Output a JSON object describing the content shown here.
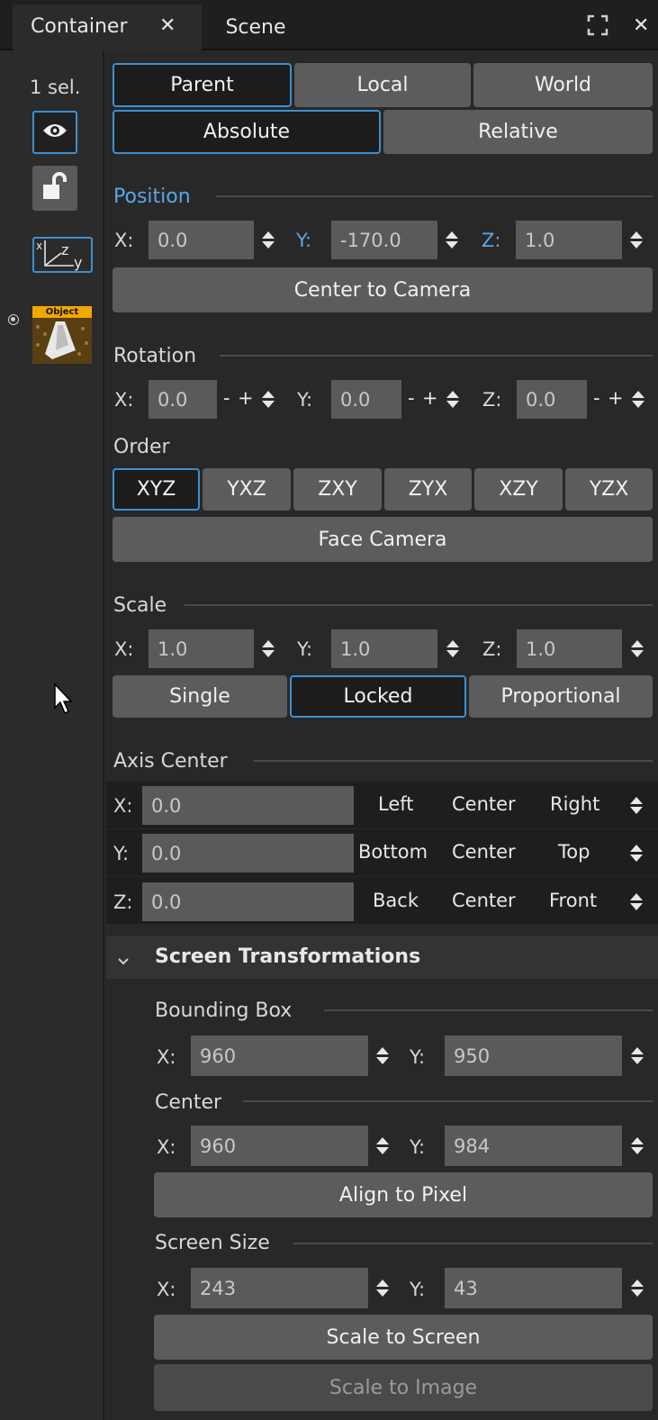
{
  "tabs": [
    {
      "label": "Container",
      "active": true,
      "closable": true
    },
    {
      "label": "Scene",
      "active": false
    }
  ],
  "side": {
    "selection_count": "1 sel.",
    "object_badge": "Object"
  },
  "ref_frame": {
    "options": [
      "Parent",
      "Local",
      "World"
    ],
    "selected": "Parent"
  },
  "mode": {
    "options": [
      "Absolute",
      "Relative"
    ],
    "selected": "Absolute"
  },
  "position": {
    "title": "Position",
    "x_label": "X:",
    "y_label": "Y:",
    "z_label": "Z:",
    "x": "0.0",
    "y": "-170.0",
    "z": "1.0",
    "center_button": "Center to Camera"
  },
  "rotation": {
    "title": "Rotation",
    "x_label": "X:",
    "y_label": "Y:",
    "z_label": "Z:",
    "x": "0.0",
    "y": "0.0",
    "z": "0.0",
    "minus": "-",
    "plus": "+"
  },
  "order": {
    "title": "Order",
    "options": [
      "XYZ",
      "YXZ",
      "ZXY",
      "ZYX",
      "XZY",
      "YZX"
    ],
    "selected": "XYZ",
    "face_button": "Face Camera"
  },
  "scale": {
    "title": "Scale",
    "x_label": "X:",
    "y_label": "Y:",
    "z_label": "Z:",
    "x": "1.0",
    "y": "1.0",
    "z": "1.0",
    "modes": [
      "Single",
      "Locked",
      "Proportional"
    ],
    "selected_mode": "Locked"
  },
  "axis_center": {
    "title": "Axis Center",
    "rows": [
      {
        "label": "X:",
        "value": "0.0",
        "options": [
          "Left",
          "Center",
          "Right"
        ]
      },
      {
        "label": "Y:",
        "value": "0.0",
        "options": [
          "Bottom",
          "Center",
          "Top"
        ]
      },
      {
        "label": "Z:",
        "value": "0.0",
        "options": [
          "Back",
          "Center",
          "Front"
        ]
      }
    ]
  },
  "screen": {
    "title": "Screen Transformations",
    "bbox": {
      "title": "Bounding Box",
      "x_label": "X:",
      "y_label": "Y:",
      "x": "960",
      "y": "950"
    },
    "center": {
      "title": "Center",
      "x_label": "X:",
      "y_label": "Y:",
      "x": "960",
      "y": "984",
      "button": "Align to Pixel"
    },
    "size": {
      "title": "Screen Size",
      "x_label": "X:",
      "y_label": "Y:",
      "x": "243",
      "y": "43",
      "button": "Scale to Screen",
      "button2": "Scale to Image"
    }
  },
  "colors": {
    "accent": "#3b90d3",
    "accent_text": "#5aa7e6",
    "panel": "#282828",
    "field": "#5a5a5a"
  }
}
